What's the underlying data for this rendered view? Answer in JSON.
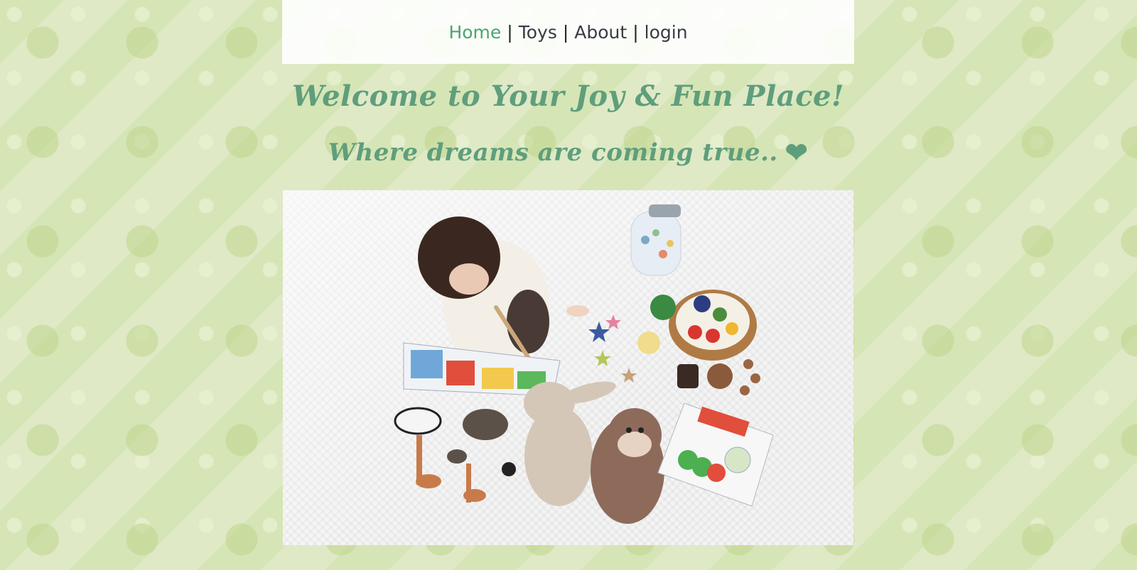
{
  "nav": {
    "items": [
      {
        "label": "Home",
        "active": true
      },
      {
        "label": "Toys",
        "active": false
      },
      {
        "label": "About",
        "active": false
      },
      {
        "label": "login",
        "active": false
      }
    ],
    "separator": "|"
  },
  "hero": {
    "heading": "Welcome to Your Joy & Fun Place!",
    "tagline": "Where dreams are coming true..",
    "tagline_icon": "heart-icon"
  },
  "colors": {
    "accent": "#5f9e7c",
    "active_link": "#4aa472",
    "background": "#dfe9c6"
  },
  "photo": {
    "subject": "child playing with toys on white blanket"
  }
}
